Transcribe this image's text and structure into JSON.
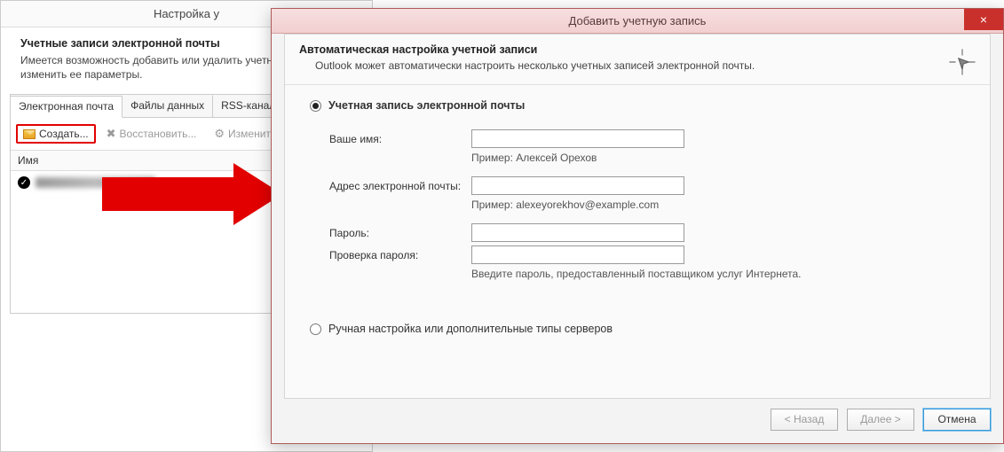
{
  "settings": {
    "title": "Настройка у",
    "header_bold": "Учетные записи электронной почты",
    "header_desc": "Имеется возможность добавить или удалить учетную запись, изменить ее параметры.",
    "tabs": [
      "Электронная почта",
      "Файлы данных",
      "RSS-каналы"
    ],
    "toolbar": {
      "create": "Создать...",
      "restore": "Восстановить...",
      "edit": "Изменить..."
    },
    "col_name": "Имя",
    "row_value": "account@example.com"
  },
  "dialog": {
    "title": "Добавить учетную запись",
    "close": "×",
    "heading": "Автоматическая настройка учетной записи",
    "subheading": "Outlook может автоматически настроить несколько учетных записей электронной почты.",
    "radio_email": "Учетная запись электронной почты",
    "radio_manual": "Ручная настройка или дополнительные типы серверов",
    "fields": {
      "name_label": "Ваше имя:",
      "name_hint": "Пример: Алексей Орехов",
      "email_label": "Адрес электронной почты:",
      "email_hint": "Пример: alexeyorekhov@example.com",
      "password_label": "Пароль:",
      "password2_label": "Проверка пароля:",
      "pwd_hint": "Введите пароль, предоставленный поставщиком услуг Интернета."
    },
    "buttons": {
      "back": "< Назад",
      "next": "Далее >",
      "cancel": "Отмена"
    }
  }
}
